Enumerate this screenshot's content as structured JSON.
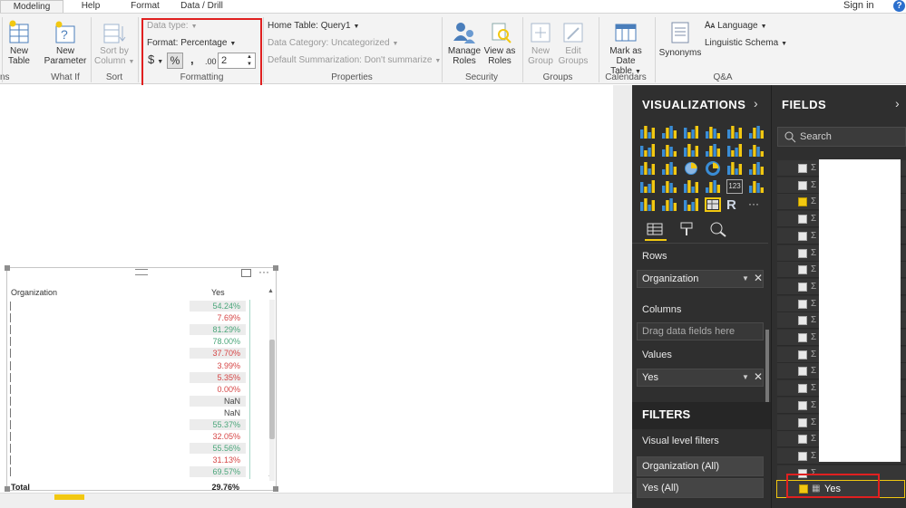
{
  "tabs": {
    "modeling": "Modeling",
    "help": "Help",
    "format": "Format",
    "data_drill": "Data / Drill",
    "sign_in": "Sign in",
    "help_icon": "?"
  },
  "ribbon": {
    "left_cut_label": "ns",
    "new_table": [
      "New",
      "Table"
    ],
    "new_parameter": [
      "New",
      "Parameter"
    ],
    "what_if": "What If",
    "sort_by_column": [
      "Sort by",
      "Column"
    ],
    "sort": "Sort",
    "data_type": "Data type:",
    "format": "Format: Percentage",
    "currency_symbol": "$",
    "percent_symbol": "%",
    "comma_symbol": ",",
    "decimal_symbol": ".00",
    "decimal_places": "2",
    "formatting": "Formatting",
    "home_table": "Home Table: Query1",
    "data_category": "Data Category: Uncategorized",
    "default_summarization": "Default Summarization: Don't summarize",
    "properties": "Properties",
    "manage_roles": [
      "Manage",
      "Roles"
    ],
    "view_as_roles": [
      "View as",
      "Roles"
    ],
    "security": "Security",
    "new_group": [
      "New",
      "Group"
    ],
    "edit_groups": [
      "Edit",
      "Groups"
    ],
    "groups": "Groups",
    "mark_as_date_table": [
      "Mark as",
      "Date Table"
    ],
    "calendars": "Calendars",
    "synonyms": "Synonyms",
    "language": "Language",
    "linguistic_schema": "Linguistic Schema",
    "qa": "Q&A"
  },
  "table_visual": {
    "col_org": "Organization",
    "col_yes": "Yes",
    "rows": [
      {
        "value": "54.24%",
        "tone": "pos"
      },
      {
        "value": "7.69%",
        "tone": "neg"
      },
      {
        "value": "81.29%",
        "tone": "pos"
      },
      {
        "value": "78.00%",
        "tone": "pos"
      },
      {
        "value": "37.70%",
        "tone": "neg"
      },
      {
        "value": "3.99%",
        "tone": "neg"
      },
      {
        "value": "5.35%",
        "tone": "neg"
      },
      {
        "value": "0.00%",
        "tone": "neg"
      },
      {
        "value": "NaN",
        "tone": "neu"
      },
      {
        "value": "NaN",
        "tone": "neu"
      },
      {
        "value": "55.37%",
        "tone": "pos"
      },
      {
        "value": "32.05%",
        "tone": "neg"
      },
      {
        "value": "55.56%",
        "tone": "pos"
      },
      {
        "value": "31.13%",
        "tone": "neg"
      },
      {
        "value": "69.57%",
        "tone": "pos"
      }
    ],
    "total_label": "Total",
    "total_value": "29.76%"
  },
  "visualizations": {
    "title": "VISUALIZATIONS",
    "rows_label": "Rows",
    "rows_field": "Organization",
    "columns_label": "Columns",
    "columns_placeholder": "Drag data fields here",
    "values_label": "Values",
    "values_field": "Yes",
    "filters_title": "FILTERS",
    "visual_level_filters": "Visual level filters",
    "filter_org": "Organization  (All)",
    "filter_yes": "Yes  (All)",
    "r_glyph": "R",
    "more_glyph": "···",
    "card_glyph": "123"
  },
  "fields": {
    "title": "FIELDS",
    "search_placeholder": "Search",
    "yes_label": "Yes",
    "checked_rows": [
      2
    ]
  },
  "colors": {
    "accent_yellow": "#f2c811",
    "highlight_red": "#e02020",
    "pane_dark": "#2f2f2f",
    "positive": "#4aa67a",
    "negative": "#d64545"
  }
}
